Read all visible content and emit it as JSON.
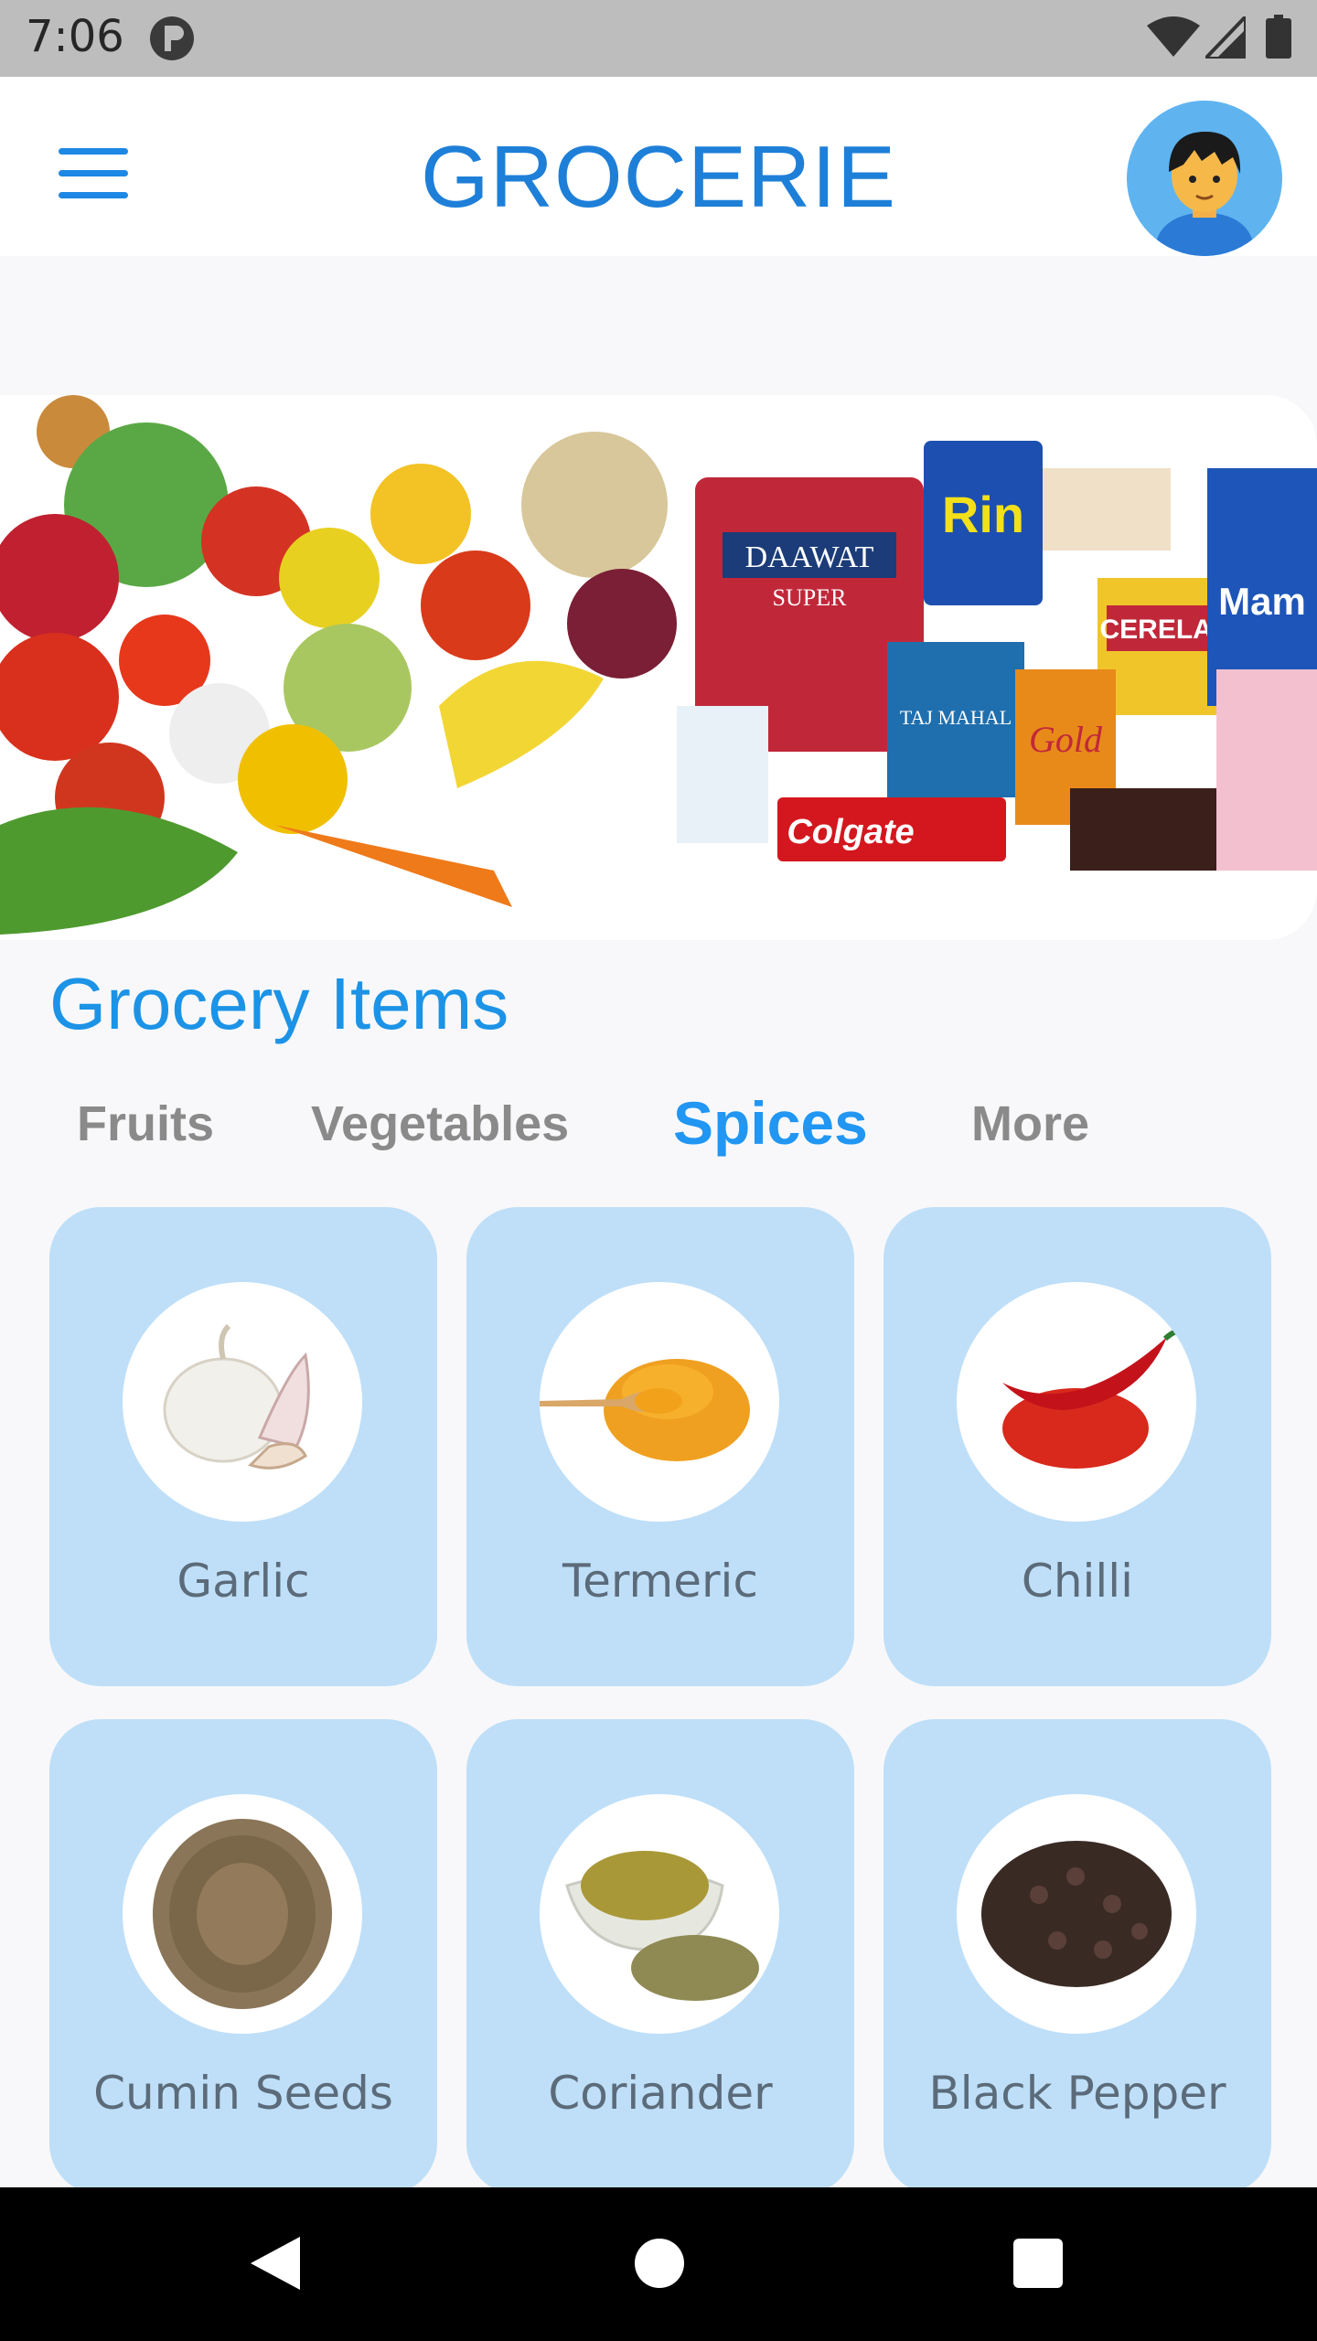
{
  "status_bar": {
    "time": "7:06"
  },
  "app_bar": {
    "title": "GROCERIE",
    "menu_icon": "hamburger-icon",
    "avatar_icon": "user-avatar"
  },
  "banner": {
    "brands": [
      "DAAWAT",
      "SUPER",
      "Rin",
      "CERELAC",
      "Mam",
      "TAJ MAHAL",
      "Gold",
      "Colgate"
    ]
  },
  "section": {
    "title": "Grocery Items"
  },
  "tabs": [
    {
      "label": "Fruits",
      "active": false
    },
    {
      "label": "Vegetables",
      "active": false
    },
    {
      "label": "Spices",
      "active": true
    },
    {
      "label": "More",
      "active": false
    }
  ],
  "items": [
    {
      "label": "Garlic",
      "icon": "garlic-image"
    },
    {
      "label": "Termeric",
      "icon": "turmeric-image"
    },
    {
      "label": "Chilli",
      "icon": "chilli-image"
    },
    {
      "label": "Cumin Seeds",
      "icon": "cumin-image"
    },
    {
      "label": "Coriander",
      "icon": "coriander-image"
    },
    {
      "label": "Black Pepper",
      "icon": "pepper-image"
    }
  ],
  "colors": {
    "accent": "#1e88e5",
    "card_bg": "#bfdff8",
    "tab_inactive": "#8a8a8a"
  }
}
